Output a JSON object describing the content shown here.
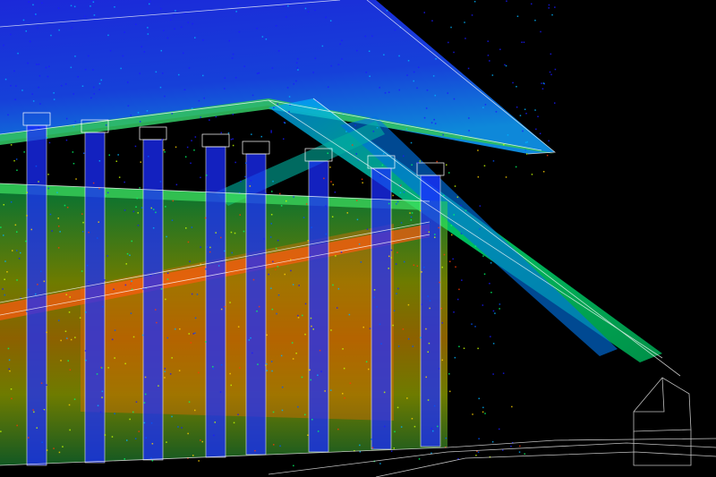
{
  "scene": {
    "kind": "point-cloud-scan-overlay",
    "background_color": "#000000",
    "wireframe_color": "#ffffff",
    "intensity_palette": [
      "#1a1aff",
      "#0055ff",
      "#00b4ff",
      "#00ff66",
      "#c8ff00",
      "#ffd200",
      "#ff3a00"
    ]
  }
}
